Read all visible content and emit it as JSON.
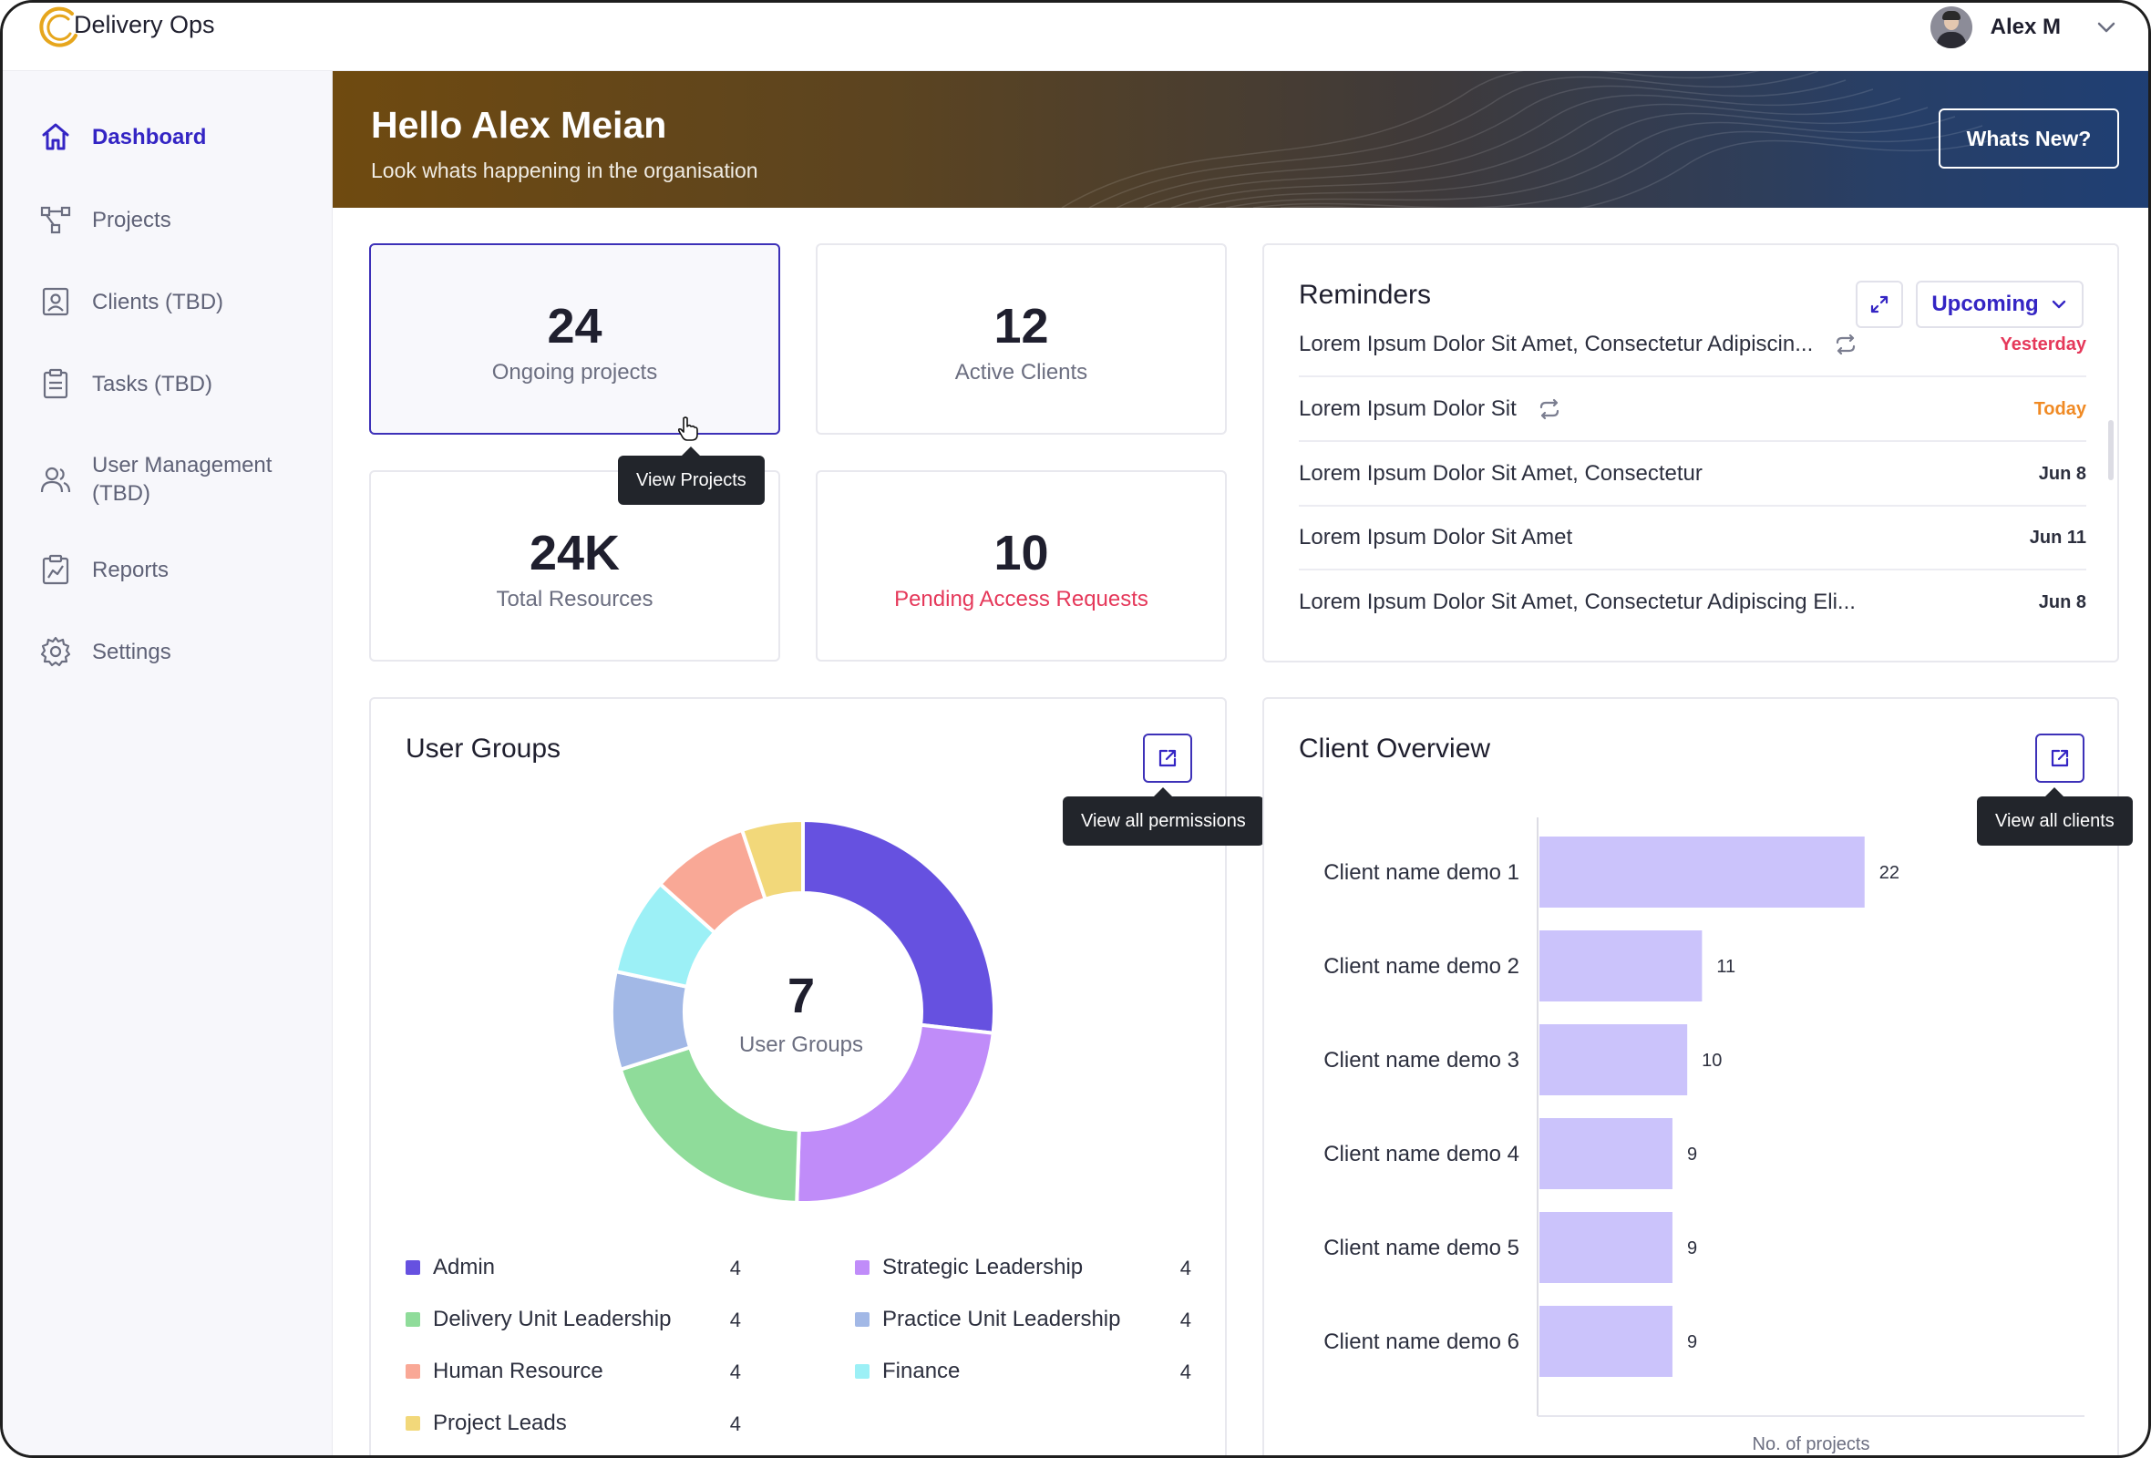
{
  "app": {
    "title": "Delivery Ops"
  },
  "user": {
    "name": "Alex M"
  },
  "sidebar": {
    "items": [
      {
        "label": "Dashboard",
        "icon": "home-icon",
        "active": true
      },
      {
        "label": "Projects",
        "icon": "projects-icon"
      },
      {
        "label": "Clients (TBD)",
        "icon": "clients-icon"
      },
      {
        "label": "Tasks (TBD)",
        "icon": "tasks-icon"
      },
      {
        "label": "User Management",
        "label2": "(TBD)",
        "icon": "users-icon"
      },
      {
        "label": "Reports",
        "icon": "reports-icon"
      },
      {
        "label": "Settings",
        "icon": "gear-icon"
      }
    ]
  },
  "banner": {
    "greeting": "Hello Alex Meian",
    "subtitle": "Look whats happening in the organisation",
    "whats_new": "Whats New?"
  },
  "stats": [
    {
      "value": "24",
      "label": "Ongoing projects"
    },
    {
      "value": "12",
      "label": "Active Clients"
    },
    {
      "value": "24K",
      "label": "Total Resources"
    },
    {
      "value": "10",
      "label": "Pending Access Requests"
    }
  ],
  "tooltips": {
    "view_projects": "View Projects",
    "view_permissions": "View all permissions",
    "view_clients": "View all clients"
  },
  "reminders": {
    "title": "Reminders",
    "filter": "Upcoming",
    "items": [
      {
        "text": "Lorem Ipsum Dolor Sit Amet, Consectetur Adipiscin...",
        "repeat": true,
        "date": "Yesterday",
        "status": "overdue"
      },
      {
        "text": "Lorem Ipsum Dolor Sit",
        "repeat": true,
        "date": "Today",
        "status": "today"
      },
      {
        "text": "Lorem Ipsum Dolor Sit Amet, Consectetur",
        "repeat": false,
        "date": "Jun 8"
      },
      {
        "text": "Lorem Ipsum Dolor Sit Amet",
        "repeat": false,
        "date": "Jun 11"
      },
      {
        "text": "Lorem Ipsum Dolor Sit Amet, Consectetur Adipiscing Eli...",
        "repeat": false,
        "date": "Jun 8"
      }
    ]
  },
  "user_groups": {
    "title": "User Groups",
    "total": "7",
    "total_label": "User Groups",
    "legend": [
      {
        "name": "Admin",
        "value": "4",
        "color": "#6651e0"
      },
      {
        "name": "Strategic Leadership",
        "value": "4",
        "color": "#c08cf9"
      },
      {
        "name": "Delivery Unit Leadership",
        "value": "4",
        "color": "#8fdc9a"
      },
      {
        "name": "Practice Unit Leadership",
        "value": "4",
        "color": "#a2b8e6"
      },
      {
        "name": "Human Resource",
        "value": "4",
        "color": "#f9a896"
      },
      {
        "name": "Finance",
        "value": "4",
        "color": "#9cf0f6"
      },
      {
        "name": "Project Leads",
        "value": "4",
        "color": "#f2d87a"
      }
    ]
  },
  "chart_data": [
    {
      "type": "pie",
      "title": "User Groups",
      "categories": [
        "Admin",
        "Strategic Leadership",
        "Delivery Unit Leadership",
        "Practice Unit Leadership",
        "Finance",
        "Human Resource",
        "Project Leads"
      ],
      "values": [
        26,
        23,
        19,
        8,
        8,
        8,
        5
      ],
      "colors": [
        "#6651e0",
        "#c08cf9",
        "#8fdc9a",
        "#a2b8e6",
        "#9cf0f6",
        "#f9a896",
        "#f2d87a"
      ]
    },
    {
      "type": "bar",
      "orientation": "horizontal",
      "title": "Client Overview",
      "categories": [
        "Client name demo 1",
        "Client name demo 2",
        "Client name demo 3",
        "Client name demo 4",
        "Client name demo 5",
        "Client name demo 6"
      ],
      "values": [
        22,
        11,
        10,
        9,
        9,
        9
      ],
      "xlabel": "No. of projects",
      "xlim": [
        0,
        37
      ],
      "color": "#cbc3fb"
    }
  ]
}
